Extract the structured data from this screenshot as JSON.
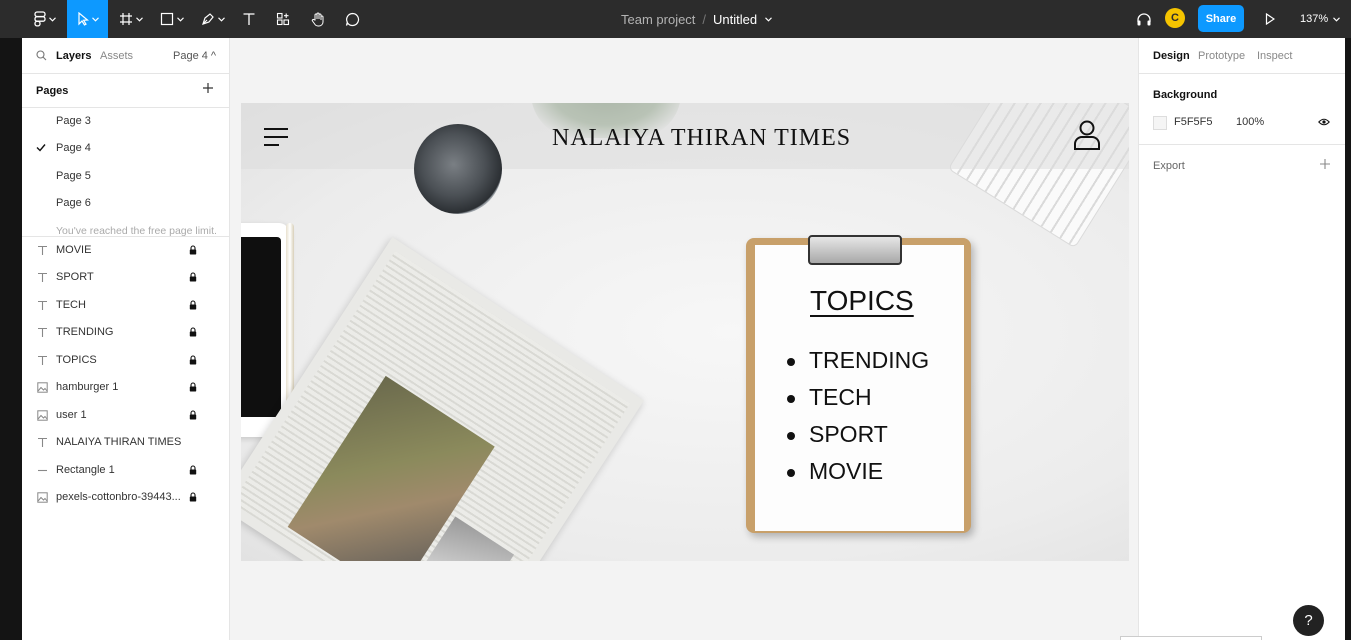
{
  "toolbar": {
    "project": "Team project",
    "separator": "/",
    "file_name": "Untitled",
    "avatar_initial": "C",
    "share_label": "Share",
    "zoom": "137%"
  },
  "left_panel": {
    "tabs": {
      "layers": "Layers",
      "assets": "Assets",
      "page_selector": "Page 4 ^"
    },
    "pages_label": "Pages",
    "pages": [
      {
        "label": "Page 3",
        "selected": false
      },
      {
        "label": "Page 4",
        "selected": true
      },
      {
        "label": "Page 5",
        "selected": false
      },
      {
        "label": "Page 6",
        "selected": false
      }
    ],
    "limit_note": "You've reached the free page limit.",
    "layers": [
      {
        "label": "MOVIE",
        "type": "text",
        "locked": true
      },
      {
        "label": "SPORT",
        "type": "text",
        "locked": true
      },
      {
        "label": "TECH",
        "type": "text",
        "locked": true
      },
      {
        "label": "TRENDING",
        "type": "text",
        "locked": true
      },
      {
        "label": "TOPICS",
        "type": "text",
        "locked": true
      },
      {
        "label": "hamburger 1",
        "type": "image",
        "locked": true
      },
      {
        "label": "user 1",
        "type": "image",
        "locked": true
      },
      {
        "label": "NALAIYA THIRAN TIMES",
        "type": "text",
        "locked": false
      },
      {
        "label": "Rectangle 1",
        "type": "rectangle",
        "locked": true
      },
      {
        "label": "pexels-cottonbro-39443...",
        "type": "image",
        "locked": true
      }
    ]
  },
  "canvas": {
    "masthead": "NALAIYA THIRAN TIMES",
    "topics_title": "TOPICS",
    "topics": [
      "TRENDING",
      "TECH",
      "SPORT",
      "MOVIE"
    ]
  },
  "right_panel": {
    "tabs": {
      "design": "Design",
      "prototype": "Prototype",
      "inspect": "Inspect"
    },
    "background_label": "Background",
    "bg_hex": "F5F5F5",
    "bg_opacity": "100%",
    "export_label": "Export"
  },
  "help_label": "?",
  "colors": {
    "accent": "#0d99ff",
    "toolbar": "#2c2c2c",
    "avatar": "#f5c400"
  }
}
